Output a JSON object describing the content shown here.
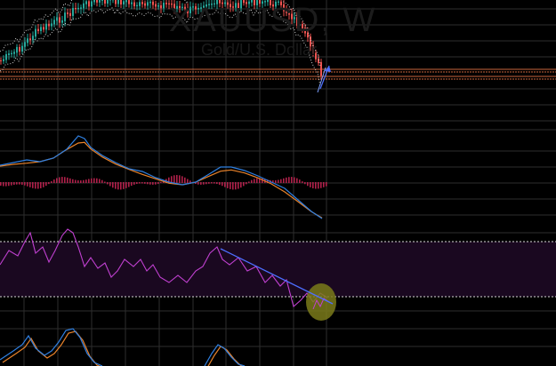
{
  "watermark": {
    "symbol": "XAUUSD, W",
    "description": "Gold/U.S. Dollar"
  },
  "colors": {
    "background": "#000000",
    "grid": "#2e2e2e",
    "candle_up": "#26a69a",
    "candle_down": "#ef5350",
    "bb_band": "#cfcfcf",
    "hline_orange": "#c8643c",
    "macd_line": "#2f7fe0",
    "signal_line": "#e8822a",
    "histogram": "#b0204a",
    "rsi_line": "#c040d0",
    "rsi_band_fill": "#1a0820",
    "rsi_levels": "#d8d8d8",
    "trendline": "#4d6fff",
    "highlight_ellipse": "#7a7a1a"
  },
  "panes": [
    "price",
    "macd",
    "rsi",
    "stochastic"
  ],
  "annotations": {
    "rsi_trendline": true,
    "rsi_highlight_ellipse": true,
    "price_blue_arrow": true
  }
}
